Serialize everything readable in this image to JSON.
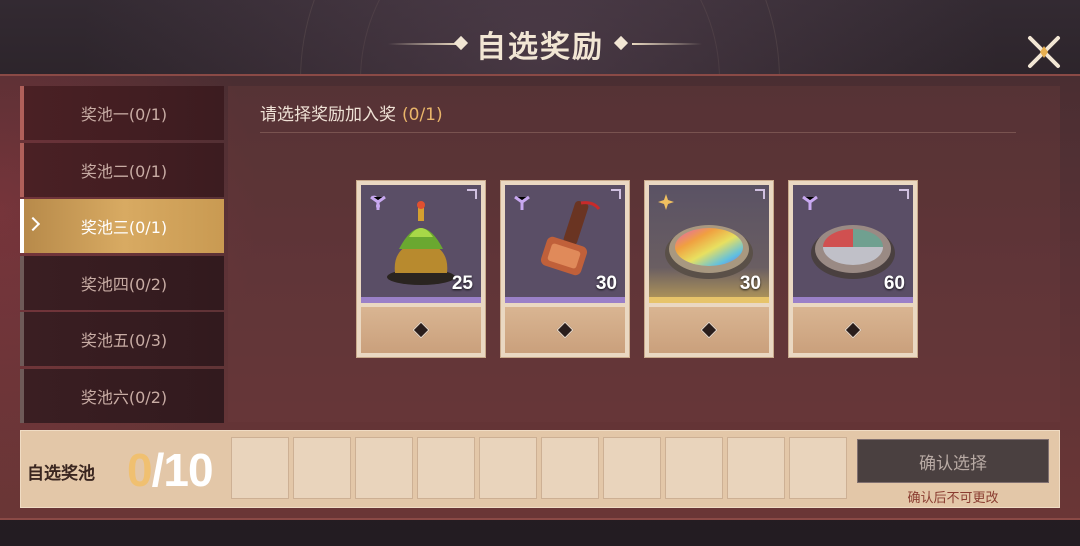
{
  "header": {
    "title": "自选奖励"
  },
  "sidebar": {
    "tabs": [
      {
        "label": "奖池一(0/1)",
        "state": "normal"
      },
      {
        "label": "奖池二(0/1)",
        "state": "normal"
      },
      {
        "label": "奖池三(0/1)",
        "state": "active"
      },
      {
        "label": "奖池四(0/2)",
        "state": "dim"
      },
      {
        "label": "奖池五(0/3)",
        "state": "dim"
      },
      {
        "label": "奖池六(0/2)",
        "state": "dim"
      }
    ]
  },
  "content": {
    "prompt": "请选择奖励加入奖",
    "prompt_count": "(0/1)",
    "items": [
      {
        "icon": "jade-censer-icon",
        "rarity": "purple",
        "quantity": "25"
      },
      {
        "icon": "copper-hammer-icon",
        "rarity": "purple",
        "quantity": "30"
      },
      {
        "icon": "rainbow-mirror-icon",
        "rarity": "gold",
        "quantity": "30"
      },
      {
        "icon": "three-color-disc-icon",
        "rarity": "purple",
        "quantity": "60"
      }
    ]
  },
  "bottom": {
    "pool_label": "自选奖池",
    "selected": "0",
    "separator": "/",
    "total": "10",
    "slots": 10,
    "confirm_label": "确认选择",
    "confirm_note": "确认后不可更改"
  },
  "colors": {
    "accent_gold": "#d8aa62",
    "count_orange": "#e9b56a",
    "panel_red": "#5a3236",
    "rarity_purple": "#9a80c8",
    "rarity_gold": "#e7c46a"
  }
}
